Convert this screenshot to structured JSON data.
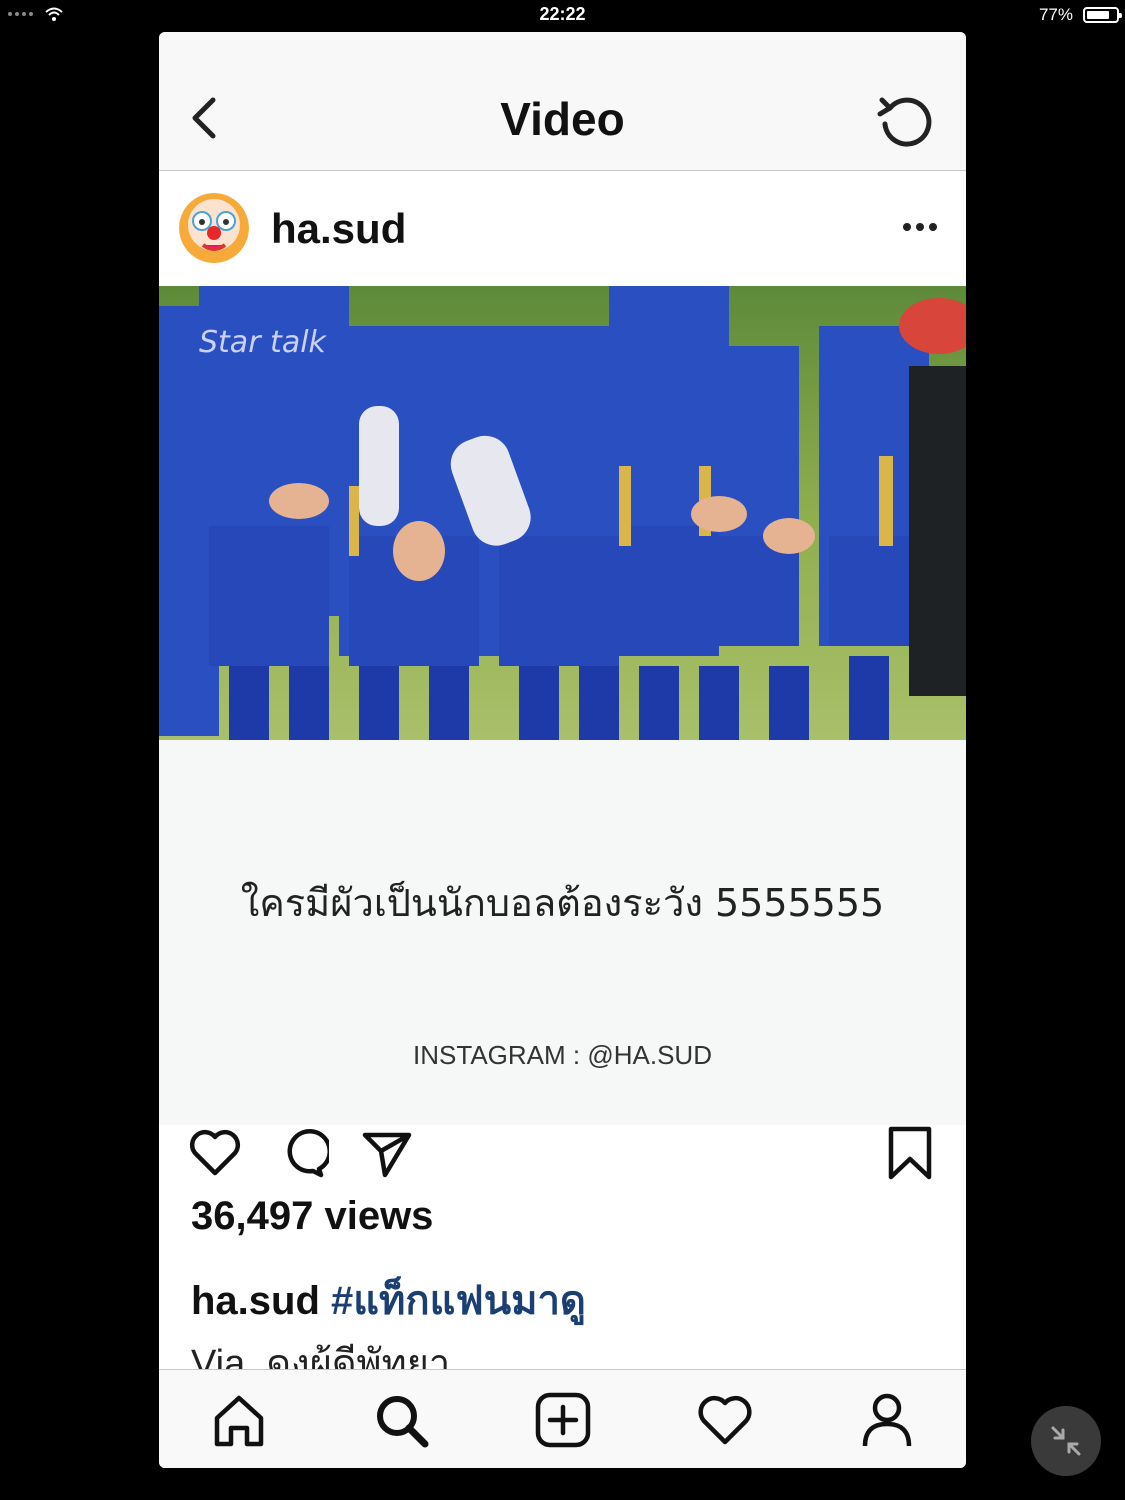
{
  "status_bar": {
    "time": "22:22",
    "battery": "77%",
    "battery_level": 0.77
  },
  "nav": {
    "title": "Video",
    "back_icon": "chevron-left-icon",
    "refresh_icon": "refresh-icon"
  },
  "post": {
    "username": "ha.sud",
    "avatar_icon": "clown-emoji-avatar",
    "more_icon": "more-dots-icon",
    "video_watermark": "Star talk",
    "video_caption": "ใครมีผัวเป็นนักบอลต้องระวัง 5555555",
    "video_credit": "INSTAGRAM  :  @HA.SUD",
    "views": "36,497 views",
    "caption_user": "ha.sud",
    "caption_tag": "#แท็กแฟนมาดู",
    "caption_line2": "Via. ดงผู้ดีพัทยา"
  },
  "actions": [
    "heart-icon",
    "comment-icon",
    "share-icon",
    "bookmark-icon"
  ],
  "tabbar": [
    "home-icon",
    "search-icon",
    "add-icon",
    "activity-heart-icon",
    "profile-icon"
  ],
  "colors": {
    "hashtag": "#1c3f73",
    "jersey_blue": "#2a4fc0",
    "grass": "#7a9a4a"
  }
}
